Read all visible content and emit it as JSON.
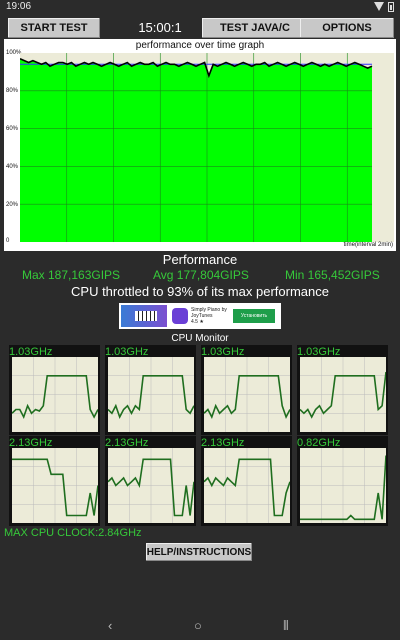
{
  "status_bar": {
    "time": "19:06"
  },
  "toolbar": {
    "start_label": "START TEST",
    "timer": "15:00:1",
    "java_label": "TEST JAVA/C",
    "options_label": "OPTIONS"
  },
  "graph": {
    "title": "performance over time graph",
    "y_ticks": [
      "100%",
      "80%",
      "60%",
      "40%",
      "20%",
      "0"
    ],
    "x_label": "time(interval 2min)",
    "fill_color": "#00ff00",
    "line_color": "#000000",
    "avg_line_color": "#3333ff",
    "performance_series": [
      97,
      96,
      95,
      96,
      95,
      94,
      95,
      93,
      94,
      95,
      95,
      94,
      95,
      93,
      94,
      95,
      94,
      95,
      94,
      93,
      94,
      95,
      94,
      93,
      94,
      95,
      93,
      94,
      95,
      94,
      94,
      95,
      93,
      94,
      95,
      94,
      94,
      93,
      94,
      95,
      94,
      93,
      94,
      95,
      88,
      94,
      93,
      94,
      95,
      94,
      93,
      94,
      95,
      94,
      93,
      94,
      94,
      95,
      93,
      94,
      95,
      94,
      93,
      94,
      95,
      94,
      93,
      94,
      95,
      94,
      93,
      94,
      93,
      94,
      95,
      94,
      93,
      94,
      95,
      94,
      93,
      92,
      93
    ]
  },
  "performance": {
    "title": "Performance",
    "max": "Max 187,163GIPS",
    "avg": "Avg 177,804GIPS",
    "min": "Min 165,452GIPS",
    "throttle": "CPU throttled to 93% of its max performance"
  },
  "ad": {
    "app_name": "Simply Piano by JoyTunes",
    "rating": "4.5 ★",
    "install": "Установить"
  },
  "cpu_monitor": {
    "title": "CPU Monitor",
    "cores": [
      {
        "freq": "1.03GHz",
        "trace": [
          0.25,
          0.3,
          0.3,
          0.2,
          0.35,
          0.25,
          0.3,
          0.28,
          0.35,
          0.75,
          0.75,
          0.75,
          0.75,
          0.75,
          0.75,
          0.75,
          0.75,
          0.75,
          0.75,
          0.75,
          0.3,
          0.2,
          0.3
        ]
      },
      {
        "freq": "1.03GHz",
        "trace": [
          0.3,
          0.25,
          0.35,
          0.2,
          0.3,
          0.35,
          0.25,
          0.35,
          0.3,
          0.75,
          0.75,
          0.75,
          0.75,
          0.75,
          0.75,
          0.75,
          0.75,
          0.75,
          0.75,
          0.75,
          0.3,
          0.25,
          0.35
        ]
      },
      {
        "freq": "1.03GHz",
        "trace": [
          0.25,
          0.3,
          0.2,
          0.35,
          0.25,
          0.3,
          0.35,
          0.25,
          0.3,
          0.75,
          0.75,
          0.75,
          0.75,
          0.75,
          0.75,
          0.75,
          0.75,
          0.75,
          0.75,
          0.75,
          0.35,
          0.2,
          0.3
        ]
      },
      {
        "freq": "1.03GHz",
        "trace": [
          0.3,
          0.25,
          0.3,
          0.2,
          0.3,
          0.35,
          0.25,
          0.3,
          0.35,
          0.75,
          0.75,
          0.75,
          0.75,
          0.75,
          0.75,
          0.75,
          0.75,
          0.75,
          0.75,
          0.75,
          0.3,
          0.35,
          0.8
        ]
      },
      {
        "freq": "2.13GHz",
        "trace": [
          0.85,
          0.85,
          0.85,
          0.85,
          0.85,
          0.85,
          0.85,
          0.85,
          0.85,
          0.85,
          0.65,
          0.65,
          0.65,
          0.65,
          0.1,
          0.1,
          0.1,
          0.1,
          0.1,
          0.1,
          0.4,
          0.1,
          0.5
        ]
      },
      {
        "freq": "2.13GHz",
        "trace": [
          0.55,
          0.6,
          0.5,
          0.55,
          0.6,
          0.5,
          0.55,
          0.6,
          0.5,
          0.85,
          0.85,
          0.85,
          0.85,
          0.85,
          0.85,
          0.85,
          0.85,
          0.1,
          0.1,
          0.1,
          0.5,
          0.1,
          0.55
        ]
      },
      {
        "freq": "2.13GHz",
        "trace": [
          0.55,
          0.6,
          0.5,
          0.6,
          0.55,
          0.5,
          0.6,
          0.55,
          0.5,
          0.85,
          0.85,
          0.85,
          0.85,
          0.85,
          0.85,
          0.85,
          0.85,
          0.85,
          0.1,
          0.1,
          0.1,
          0.4,
          0.55
        ]
      },
      {
        "freq": "0.82GHz",
        "trace": [
          0.05,
          0.05,
          0.05,
          0.05,
          0.05,
          0.05,
          0.05,
          0.05,
          0.05,
          0.05,
          0.05,
          0.05,
          0.05,
          0.1,
          0.05,
          0.05,
          0.05,
          0.05,
          0.05,
          0.05,
          0.4,
          0.05,
          0.9
        ]
      }
    ]
  },
  "footer": {
    "max_clock": "MAX CPU CLOCK:2.84GHz",
    "help_label": "HELP/INSTRUCTIONS"
  },
  "nav": {
    "back": "‹",
    "home": "○",
    "recents": "⦀"
  }
}
